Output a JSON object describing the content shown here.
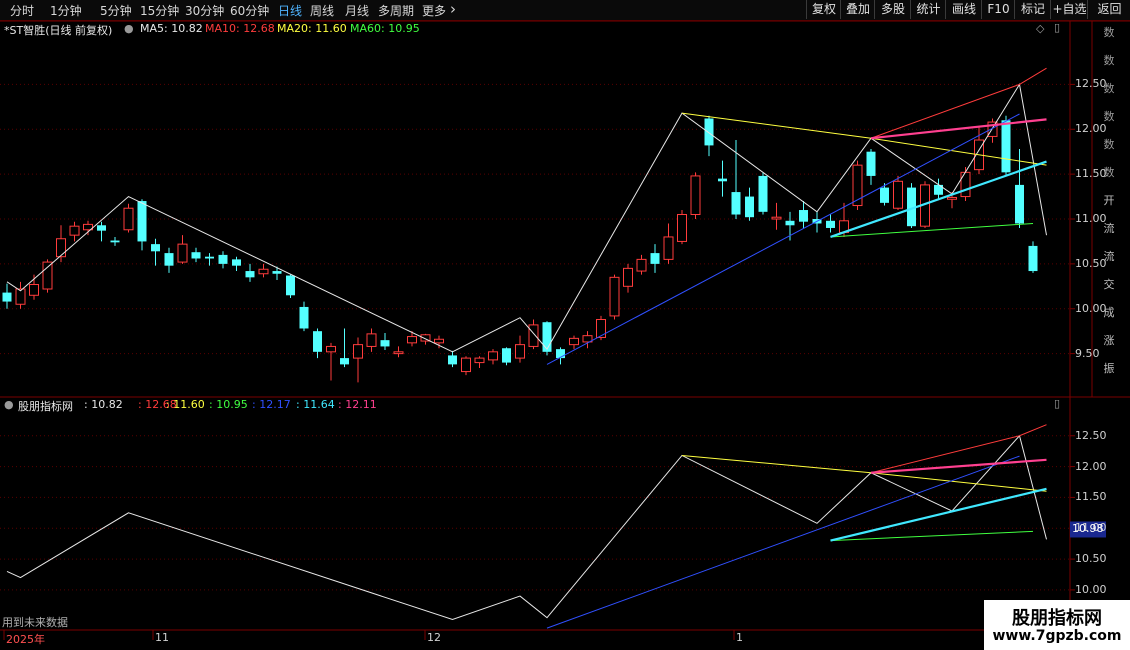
{
  "toolbar": {
    "timeframes": [
      {
        "label": "分时",
        "active": false
      },
      {
        "label": "1分钟",
        "active": false
      },
      {
        "label": "5分钟",
        "active": false
      },
      {
        "label": "15分钟",
        "active": false
      },
      {
        "label": "30分钟",
        "active": false
      },
      {
        "label": "60分钟",
        "active": false
      },
      {
        "label": "日线",
        "active": true
      },
      {
        "label": "周线",
        "active": false
      },
      {
        "label": "月线",
        "active": false
      },
      {
        "label": "多周期",
        "active": false
      },
      {
        "label": "更多",
        "active": false
      }
    ],
    "buttons": [
      "复权",
      "叠加",
      "多股",
      "统计",
      "画线",
      "F10",
      "标记",
      "+自选",
      "返回"
    ]
  },
  "main_legend": {
    "title": "*ST智胜(日线 前复权)",
    "items": [
      {
        "text": "MA5: 10.82",
        "color": "#e8e8e8"
      },
      {
        "text": "MA10: 12.68",
        "color": "#ff3c3c"
      },
      {
        "text": "MA20: 11.60",
        "color": "#ffff40"
      },
      {
        "text": "MA60: 10.95",
        "color": "#40ff40"
      }
    ]
  },
  "indicator_legend": {
    "title": "股朋指标网",
    "items": [
      {
        "text": ": 10.82",
        "color": "#e8e8e8"
      },
      {
        "text": ": 12.68",
        "color": "#ff3c3c"
      },
      {
        "text": ": 11.60",
        "color": "#ffff40"
      },
      {
        "text": ": 10.95",
        "color": "#40ff40"
      },
      {
        "text": ": 12.17",
        "color": "#3050ff"
      },
      {
        "text": ": 11.64",
        "color": "#40e8ff"
      },
      {
        "text": ": 12.11",
        "color": "#ff4090"
      }
    ]
  },
  "price_axis_main": [
    "12.50",
    "12.00",
    "11.50",
    "11.00",
    "10.50",
    "10.00",
    "9.50"
  ],
  "price_axis_indicator": [
    "12.50",
    "12.00",
    "11.50",
    "11.00",
    "10.50",
    "10.00"
  ],
  "current_value_box": "10.98",
  "future_data_note": "用到未来数据",
  "date_axis": [
    "2025年",
    "11",
    "12",
    "1"
  ],
  "side_panel_chars": [
    "数",
    "数",
    "数",
    "数",
    "数",
    "数",
    "开",
    "流",
    "流",
    "交",
    "成",
    "涨",
    "振"
  ],
  "watermark": {
    "title": "股朋指标网",
    "url": "www.7gpzb.com"
  },
  "colors": {
    "up": "#ff3c3c",
    "down": "#54ffff",
    "bg": "#000000",
    "grid": "#5a0000"
  },
  "chart_data": {
    "type": "candlestick",
    "title": "*ST智胜(日线 前复权)",
    "y_range": [
      9.05,
      12.95
    ],
    "candles": [
      {
        "o": 10.18,
        "c": 10.08,
        "h": 10.28,
        "l": 10.0
      },
      {
        "o": 10.05,
        "c": 10.22,
        "h": 10.3,
        "l": 10.0
      },
      {
        "o": 10.15,
        "c": 10.27,
        "h": 10.38,
        "l": 10.1
      },
      {
        "o": 10.22,
        "c": 10.52,
        "h": 10.55,
        "l": 10.18
      },
      {
        "o": 10.58,
        "c": 10.78,
        "h": 10.93,
        "l": 10.52
      },
      {
        "o": 10.82,
        "c": 10.92,
        "h": 10.97,
        "l": 10.75
      },
      {
        "o": 10.88,
        "c": 10.94,
        "h": 10.98,
        "l": 10.82
      },
      {
        "o": 10.93,
        "c": 10.87,
        "h": 10.97,
        "l": 10.75
      },
      {
        "o": 10.76,
        "c": 10.74,
        "h": 10.8,
        "l": 10.7
      },
      {
        "o": 10.88,
        "c": 11.12,
        "h": 11.17,
        "l": 10.85
      },
      {
        "o": 11.2,
        "c": 10.75,
        "h": 11.22,
        "l": 10.65
      },
      {
        "o": 10.72,
        "c": 10.64,
        "h": 10.78,
        "l": 10.48
      },
      {
        "o": 10.62,
        "c": 10.48,
        "h": 10.68,
        "l": 10.4
      },
      {
        "o": 10.52,
        "c": 10.72,
        "h": 10.82,
        "l": 10.5
      },
      {
        "o": 10.63,
        "c": 10.56,
        "h": 10.68,
        "l": 10.52
      },
      {
        "o": 10.58,
        "c": 10.56,
        "h": 10.62,
        "l": 10.48
      },
      {
        "o": 10.6,
        "c": 10.5,
        "h": 10.64,
        "l": 10.45
      },
      {
        "o": 10.55,
        "c": 10.48,
        "h": 10.58,
        "l": 10.42
      },
      {
        "o": 10.42,
        "c": 10.35,
        "h": 10.5,
        "l": 10.3
      },
      {
        "o": 10.39,
        "c": 10.44,
        "h": 10.5,
        "l": 10.35
      },
      {
        "o": 10.42,
        "c": 10.39,
        "h": 10.47,
        "l": 10.32
      },
      {
        "o": 10.37,
        "c": 10.15,
        "h": 10.38,
        "l": 10.12
      },
      {
        "o": 10.02,
        "c": 9.78,
        "h": 10.08,
        "l": 9.75
      },
      {
        "o": 9.75,
        "c": 9.52,
        "h": 9.78,
        "l": 9.45
      },
      {
        "o": 9.52,
        "c": 9.58,
        "h": 9.62,
        "l": 9.2
      },
      {
        "o": 9.45,
        "c": 9.38,
        "h": 9.78,
        "l": 9.35
      },
      {
        "o": 9.45,
        "c": 9.6,
        "h": 9.68,
        "l": 9.18
      },
      {
        "o": 9.58,
        "c": 9.72,
        "h": 9.78,
        "l": 9.52
      },
      {
        "o": 9.65,
        "c": 9.58,
        "h": 9.73,
        "l": 9.54
      },
      {
        "o": 9.5,
        "c": 9.52,
        "h": 9.58,
        "l": 9.46
      },
      {
        "o": 9.62,
        "c": 9.69,
        "h": 9.75,
        "l": 9.58
      },
      {
        "o": 9.64,
        "c": 9.71,
        "h": 9.72,
        "l": 9.6
      },
      {
        "o": 9.62,
        "c": 9.66,
        "h": 9.7,
        "l": 9.56
      },
      {
        "o": 9.48,
        "c": 9.38,
        "h": 9.53,
        "l": 9.35
      },
      {
        "o": 9.3,
        "c": 9.45,
        "h": 9.47,
        "l": 9.26
      },
      {
        "o": 9.4,
        "c": 9.45,
        "h": 9.47,
        "l": 9.34
      },
      {
        "o": 9.43,
        "c": 9.52,
        "h": 9.55,
        "l": 9.38
      },
      {
        "o": 9.56,
        "c": 9.4,
        "h": 9.57,
        "l": 9.37
      },
      {
        "o": 9.45,
        "c": 9.6,
        "h": 9.7,
        "l": 9.4
      },
      {
        "o": 9.58,
        "c": 9.82,
        "h": 9.88,
        "l": 9.55
      },
      {
        "o": 9.85,
        "c": 9.52,
        "h": 9.86,
        "l": 9.48
      },
      {
        "o": 9.55,
        "c": 9.45,
        "h": 9.57,
        "l": 9.38
      },
      {
        "o": 9.6,
        "c": 9.67,
        "h": 9.7,
        "l": 9.55
      },
      {
        "o": 9.63,
        "c": 9.7,
        "h": 9.75,
        "l": 9.56
      },
      {
        "o": 9.68,
        "c": 9.88,
        "h": 9.92,
        "l": 9.65
      },
      {
        "o": 9.92,
        "c": 10.35,
        "h": 10.38,
        "l": 9.88
      },
      {
        "o": 10.25,
        "c": 10.45,
        "h": 10.5,
        "l": 10.18
      },
      {
        "o": 10.42,
        "c": 10.55,
        "h": 10.6,
        "l": 10.38
      },
      {
        "o": 10.62,
        "c": 10.5,
        "h": 10.72,
        "l": 10.4
      },
      {
        "o": 10.55,
        "c": 10.8,
        "h": 10.95,
        "l": 10.5
      },
      {
        "o": 10.75,
        "c": 11.05,
        "h": 11.1,
        "l": 10.72
      },
      {
        "o": 11.05,
        "c": 11.48,
        "h": 11.52,
        "l": 11.0
      },
      {
        "o": 12.12,
        "c": 11.82,
        "h": 12.15,
        "l": 11.7
      },
      {
        "o": 11.45,
        "c": 11.42,
        "h": 11.65,
        "l": 11.25
      },
      {
        "o": 11.3,
        "c": 11.05,
        "h": 11.88,
        "l": 11.0
      },
      {
        "o": 11.25,
        "c": 11.02,
        "h": 11.35,
        "l": 10.98
      },
      {
        "o": 11.48,
        "c": 11.08,
        "h": 11.52,
        "l": 11.05
      },
      {
        "o": 11.0,
        "c": 11.02,
        "h": 11.18,
        "l": 10.88
      },
      {
        "o": 10.98,
        "c": 10.93,
        "h": 11.08,
        "l": 10.76
      },
      {
        "o": 11.1,
        "c": 10.97,
        "h": 11.2,
        "l": 10.9
      },
      {
        "o": 11.0,
        "c": 10.95,
        "h": 11.08,
        "l": 10.85
      },
      {
        "o": 10.98,
        "c": 10.9,
        "h": 11.05,
        "l": 10.85
      },
      {
        "o": 10.85,
        "c": 10.98,
        "h": 11.18,
        "l": 10.8
      },
      {
        "o": 11.15,
        "c": 11.6,
        "h": 11.65,
        "l": 11.1
      },
      {
        "o": 11.75,
        "c": 11.48,
        "h": 11.78,
        "l": 11.38
      },
      {
        "o": 11.35,
        "c": 11.18,
        "h": 11.4,
        "l": 11.15
      },
      {
        "o": 11.12,
        "c": 11.42,
        "h": 11.48,
        "l": 11.1
      },
      {
        "o": 11.35,
        "c": 10.92,
        "h": 11.4,
        "l": 10.9
      },
      {
        "o": 10.92,
        "c": 11.38,
        "h": 11.42,
        "l": 10.9
      },
      {
        "o": 11.38,
        "c": 11.27,
        "h": 11.45,
        "l": 11.22
      },
      {
        "o": 11.22,
        "c": 11.24,
        "h": 11.3,
        "l": 11.12
      },
      {
        "o": 11.25,
        "c": 11.52,
        "h": 11.58,
        "l": 11.2
      },
      {
        "o": 11.55,
        "c": 11.88,
        "h": 12.02,
        "l": 11.5
      },
      {
        "o": 11.92,
        "c": 12.08,
        "h": 12.12,
        "l": 11.85
      },
      {
        "o": 12.1,
        "c": 11.52,
        "h": 12.15,
        "l": 11.48
      },
      {
        "o": 11.38,
        "c": 10.95,
        "h": 11.78,
        "l": 10.9
      },
      {
        "o": 10.7,
        "c": 10.42,
        "h": 10.75,
        "l": 10.4
      }
    ],
    "indicator_lines": [
      {
        "name": "MA5",
        "color": "#e8e8e8",
        "points": [
          [
            0,
            10.3
          ],
          [
            1,
            10.2
          ],
          [
            9,
            11.25
          ],
          [
            33,
            9.52
          ],
          [
            38,
            9.9
          ],
          [
            40,
            9.55
          ],
          [
            50,
            12.18
          ],
          [
            60,
            11.08
          ],
          [
            64,
            11.9
          ],
          [
            70,
            11.28
          ],
          [
            75,
            12.5
          ],
          [
            77,
            10.82
          ]
        ]
      },
      {
        "name": "MA10",
        "color": "#ff3c3c",
        "points": [
          [
            64,
            11.9
          ],
          [
            75,
            12.5
          ],
          [
            77,
            12.68
          ]
        ]
      },
      {
        "name": "MA20",
        "color": "#ffff40",
        "points": [
          [
            50,
            12.18
          ],
          [
            64,
            11.9
          ],
          [
            77,
            11.6
          ]
        ]
      },
      {
        "name": "MA60",
        "color": "#40ff40",
        "points": [
          [
            61,
            10.8
          ],
          [
            76,
            10.95
          ]
        ]
      },
      {
        "name": "trend1",
        "color": "#3050ff",
        "points": [
          [
            40,
            9.38
          ],
          [
            75,
            12.17
          ]
        ]
      },
      {
        "name": "trend2",
        "color": "#40e8ff",
        "points": [
          [
            61,
            10.8
          ],
          [
            77,
            11.64
          ]
        ]
      },
      {
        "name": "trend3",
        "color": "#ff4090",
        "points": [
          [
            64,
            11.9
          ],
          [
            77,
            12.11
          ]
        ]
      }
    ]
  }
}
